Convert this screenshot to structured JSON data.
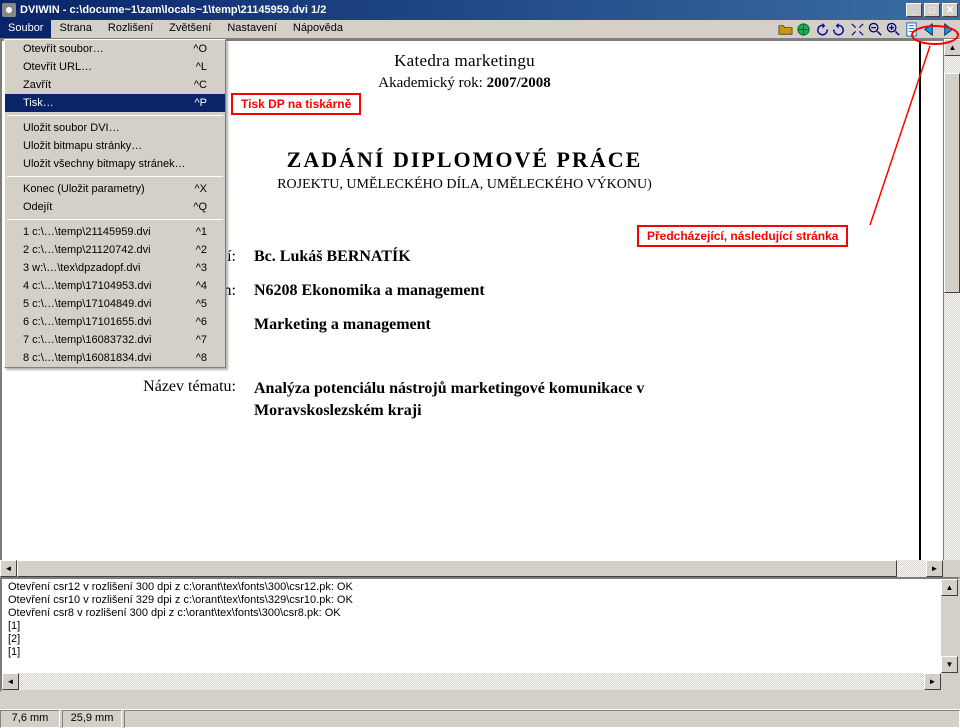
{
  "title": "DVIWIN - c:\\docume~1\\zam\\locals~1\\temp\\21145959.dvi  1/2",
  "menus": {
    "soubor": "Soubor",
    "strana": "Strana",
    "rozliseni": "Rozlišení",
    "zvetseni": "Zvětšení",
    "nastaveni": "Nastavení",
    "napoveda": "Nápověda"
  },
  "dropdown": {
    "g1": [
      {
        "l": "Otevřít soubor…",
        "s": "^O"
      },
      {
        "l": "Otevřít URL…",
        "s": "^L"
      },
      {
        "l": "Zavřít",
        "s": "^C"
      },
      {
        "l": "Tisk…",
        "s": "^P",
        "hover": true
      }
    ],
    "g2": [
      {
        "l": "Uložit soubor DVI…",
        "s": ""
      },
      {
        "l": "Uložit bitmapu stránky…",
        "s": ""
      },
      {
        "l": "Uložit všechny bitmapy stránek…",
        "s": ""
      }
    ],
    "g3": [
      {
        "l": "Konec   (Uložit parametry)",
        "s": "^X"
      },
      {
        "l": "Odejít",
        "s": "^Q"
      }
    ],
    "g4": [
      {
        "l": "1 c:\\…\\temp\\21145959.dvi",
        "s": "^1"
      },
      {
        "l": "2 c:\\…\\temp\\21120742.dvi",
        "s": "^2"
      },
      {
        "l": "3 w:\\…\\tex\\dpzadopf.dvi",
        "s": "^3"
      },
      {
        "l": "4 c:\\…\\temp\\17104953.dvi",
        "s": "^4"
      },
      {
        "l": "5 c:\\…\\temp\\17104849.dvi",
        "s": "^5"
      },
      {
        "l": "6 c:\\…\\temp\\17101655.dvi",
        "s": "^6"
      },
      {
        "l": "7 c:\\…\\temp\\16083732.dvi",
        "s": "^7"
      },
      {
        "l": "8 c:\\…\\temp\\16081834.dvi",
        "s": "^8"
      }
    ]
  },
  "doc": {
    "header1": "Katedra marketingu",
    "header2a": "Akademický rok: ",
    "header2b": "2007/2008",
    "title": "ZADÁNÍ DIPLOMOVÉ PRÁCE",
    "subtitle": "ROJEKTU, UMĚLECKÉHO DÍLA, UMĚLECKÉHO VÝKONU)",
    "rows": [
      {
        "lab": "í:",
        "val": "Bc. Lukáš BERNATÍK",
        "bold": true
      },
      {
        "lab": "n:",
        "val": "N6208 Ekonomika a management",
        "bold": true
      },
      {
        "lab": "",
        "val": "Marketing a management",
        "bold": true
      },
      {
        "lab": "Název tématu:",
        "val": "Analýza potenciálu nástrojů marketingové komunikace v Moravskoslezském kraji",
        "bold": true
      }
    ]
  },
  "callouts": {
    "c1": "Tisk DP na tiskárně",
    "c2": "Předcházející, následující stránka"
  },
  "log": [
    "Otevření csr12 v rozlišení 300 dpi z c:\\orant\\tex\\fonts\\300\\csr12.pk:   OK",
    "Otevření csr10 v rozlišení 329 dpi z c:\\orant\\tex\\fonts\\329\\csr10.pk:   OK",
    "Otevření csr8 v rozlišení 300 dpi z c:\\orant\\tex\\fonts\\300\\csr8.pk:     OK",
    "[1]",
    "[2]",
    "[1]"
  ],
  "status": {
    "x": "7,6 mm",
    "y": "25,9 mm"
  }
}
